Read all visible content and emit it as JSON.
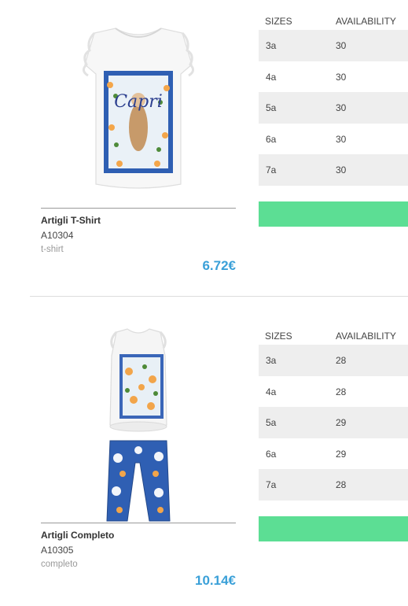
{
  "products": [
    {
      "name": "Artigli T-Shirt",
      "code": "A10304",
      "category": "t-shirt",
      "price": "6.72€",
      "image_icon": "tshirt-capri-print-image",
      "sizes_header": "SIZES",
      "availability_header": "AVAILABILITY",
      "rows": [
        {
          "size": "3a",
          "availability": "30"
        },
        {
          "size": "4a",
          "availability": "30"
        },
        {
          "size": "5a",
          "availability": "30"
        },
        {
          "size": "6a",
          "availability": "30"
        },
        {
          "size": "7a",
          "availability": "30"
        }
      ],
      "cta_color": "#5cde94"
    },
    {
      "name": "Artigli Completo",
      "code": "A10305",
      "category": "completo",
      "price": "10.14€",
      "image_icon": "completo-top-and-leggings-image",
      "sizes_header": "SIZES",
      "availability_header": "AVAILABILITY",
      "rows": [
        {
          "size": "3a",
          "availability": "28"
        },
        {
          "size": "4a",
          "availability": "28"
        },
        {
          "size": "5a",
          "availability": "29"
        },
        {
          "size": "6a",
          "availability": "29"
        },
        {
          "size": "7a",
          "availability": "28"
        }
      ],
      "cta_color": "#5cde94"
    }
  ],
  "colors": {
    "price": "#3aa0d8",
    "cta": "#5cde94",
    "row_shade": "#eeeeee"
  }
}
